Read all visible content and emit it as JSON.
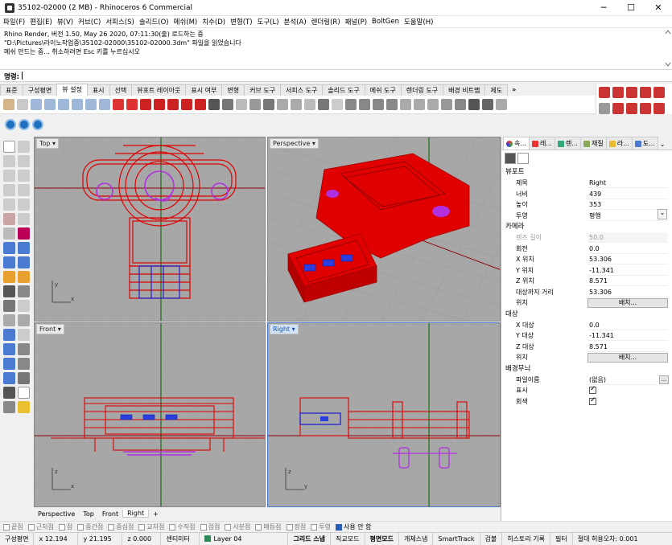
{
  "window": {
    "title": "35102-02000 (2 MB) - Rhinoceros 6 Commercial",
    "minimize": "─",
    "maximize": "☐",
    "close": "✕"
  },
  "menu": [
    "파일(F)",
    "편집(E)",
    "뷰(V)",
    "커브(C)",
    "서피스(S)",
    "솔리드(O)",
    "메쉬(M)",
    "치수(D)",
    "변형(T)",
    "도구(L)",
    "분석(A)",
    "렌더링(R)",
    "패널(P)",
    "BoltGen",
    "도움말(H)"
  ],
  "history": [
    "Rhino Render, 버전 1.50, May 26 2020, 07:11:30(출) 로드하는 중",
    "\"D:\\Pictures\\라이노작업중\\35102-02000\\35102-02000.3dm\" 파일을 읽었습니다",
    "메쉬 만드는 중... 취소하려면 Esc 키를 누르십시오"
  ],
  "command": {
    "label": "명령:",
    "value": ""
  },
  "toolbar_tabs": [
    "표준",
    "구성평면",
    "뷰 설정",
    "표시",
    "선택",
    "뷰포트 레이아웃",
    "표시 여부",
    "변형",
    "커브 도구",
    "서피스 도구",
    "솔리드 도구",
    "메쉬 도구",
    "렌더링 도구",
    "배경 비트맵",
    "제도",
    "»"
  ],
  "toolbar_active_tab": "뷰 설정",
  "viewports": {
    "top": {
      "label": "Top",
      "axis_x": "x",
      "axis_y": "y"
    },
    "perspective": {
      "label": "Perspective"
    },
    "front": {
      "label": "Front",
      "axis_x": "x",
      "axis_y": "z"
    },
    "right": {
      "label": "Right",
      "axis_x": "y",
      "axis_y": "z"
    }
  },
  "viewport_tabs": [
    "Perspective",
    "Top",
    "Front",
    "Right",
    "+"
  ],
  "viewport_active_tab": "Right",
  "osnaps": [
    {
      "label": "끝점",
      "on": false
    },
    {
      "label": "근처점",
      "on": false
    },
    {
      "label": "점",
      "on": false
    },
    {
      "label": "중간점",
      "on": false
    },
    {
      "label": "중심점",
      "on": false
    },
    {
      "label": "교차점",
      "on": false
    },
    {
      "label": "수직점",
      "on": false
    },
    {
      "label": "접점",
      "on": false
    },
    {
      "label": "사분점",
      "on": false
    },
    {
      "label": "매듭점",
      "on": false
    },
    {
      "label": "정점",
      "on": false
    },
    {
      "label": "투영",
      "on": false
    },
    {
      "label": "사용 안 함",
      "on": true
    }
  ],
  "status": {
    "cplane": "구성평면",
    "x": "x 12.194",
    "y": "y 21.195",
    "z": "z 0.000",
    "units": "센티미터",
    "layer": "Layer 04",
    "grid_snap": "그리드 스냅",
    "ortho": "직교모드",
    "planar": "평면모드",
    "osnap": "개체스냅",
    "smarttrack": "SmartTrack",
    "gumball": "검볼",
    "history": "히스토리 기록",
    "filter": "필터",
    "tolerance": "절대 허용오차: 0.001"
  },
  "panel": {
    "tabs": [
      "속...",
      "레...",
      "렌...",
      "재질",
      "라...",
      "도..."
    ],
    "viewport_section": "뷰포트",
    "viewport_rows": [
      {
        "k": "제목",
        "v": "Right"
      },
      {
        "k": "너비",
        "v": "439"
      },
      {
        "k": "높이",
        "v": "353"
      },
      {
        "k": "투영",
        "v": "평행"
      }
    ],
    "camera_section": "카메라",
    "camera_rows": [
      {
        "k": "렌즈 길이",
        "v": "50.0"
      },
      {
        "k": "회전",
        "v": "0.0"
      },
      {
        "k": "X 위치",
        "v": "53.306"
      },
      {
        "k": "Y 위치",
        "v": "-11.341"
      },
      {
        "k": "Z 위치",
        "v": "8.571"
      },
      {
        "k": "대상까지 거리",
        "v": "53.306"
      }
    ],
    "camera_pos_label": "위치",
    "place_button": "배치...",
    "target_section": "대상",
    "target_rows": [
      {
        "k": "X 대상",
        "v": "0.0"
      },
      {
        "k": "Y 대상",
        "v": "-11.341"
      },
      {
        "k": "Z 대상",
        "v": "8.571"
      }
    ],
    "target_pos_label": "위치",
    "target_place_button": "배치...",
    "wallpaper_section": "배경무늬",
    "filename_label": "파일이름",
    "filename_value": "(없음)",
    "browse_button": "...",
    "show_label": "표시",
    "grey_label": "회색"
  },
  "colors": {
    "model_red": "#e00000",
    "model_blue": "#2222cc",
    "model_purple": "#b030e0",
    "viewport_bg": "#a8a8a8",
    "grid": "#999999",
    "x_axis": "#8b0000",
    "y_axis": "#006400"
  }
}
